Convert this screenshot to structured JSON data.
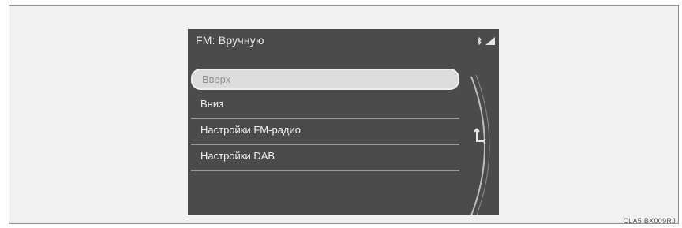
{
  "screen": {
    "title": "FM: Вручную",
    "menu_items": [
      {
        "label": "Вверх",
        "selected": true
      },
      {
        "label": "Вниз",
        "selected": false
      },
      {
        "label": "Настройки FM-радио",
        "selected": false
      },
      {
        "label": "Настройки DAB",
        "selected": false
      }
    ],
    "status_icons": [
      "bluetooth-icon",
      "signal-strength-icon",
      "battery-icon"
    ]
  },
  "caption": "CLA5IBX009RJ",
  "colors": {
    "screen_bg": "#4b4b4b",
    "selected_bg": "#dcdcdc",
    "text": "#f0f0f0"
  }
}
